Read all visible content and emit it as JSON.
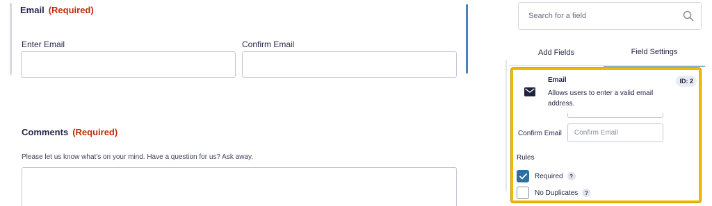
{
  "form": {
    "email_field": {
      "title": "Email",
      "required": "(Required)",
      "enter_label": "Enter Email",
      "confirm_label": "Confirm Email",
      "enter_value": "",
      "confirm_value": ""
    },
    "comments_field": {
      "title": "Comments",
      "required": "(Required)",
      "description": "Please let us know what's on your mind. Have a question for us? Ask away.",
      "value": ""
    }
  },
  "panel": {
    "search": {
      "placeholder": "Search for a field",
      "icon": "search-icon"
    },
    "tabs": [
      {
        "label": "Add Fields",
        "active": false
      },
      {
        "label": "Field Settings",
        "active": true
      }
    ],
    "card": {
      "icon": "envelope-icon",
      "title": "Email",
      "description": "Allows users to enter a valid email address.",
      "id_badge": "ID: 2"
    },
    "confirm_email": {
      "label": "Confirm Email",
      "placeholder": "Confirm Email"
    },
    "rules": {
      "heading": "Rules",
      "items": [
        {
          "label": "Required",
          "checked": true,
          "help": "?"
        },
        {
          "label": "No Duplicates",
          "checked": false,
          "help": "?"
        }
      ]
    }
  },
  "colors": {
    "required_red": "#c02b0a",
    "highlight_yellow": "#f2b705",
    "accent_blue": "#2f6f9f",
    "active_tab_underline": "#3e7da6"
  }
}
